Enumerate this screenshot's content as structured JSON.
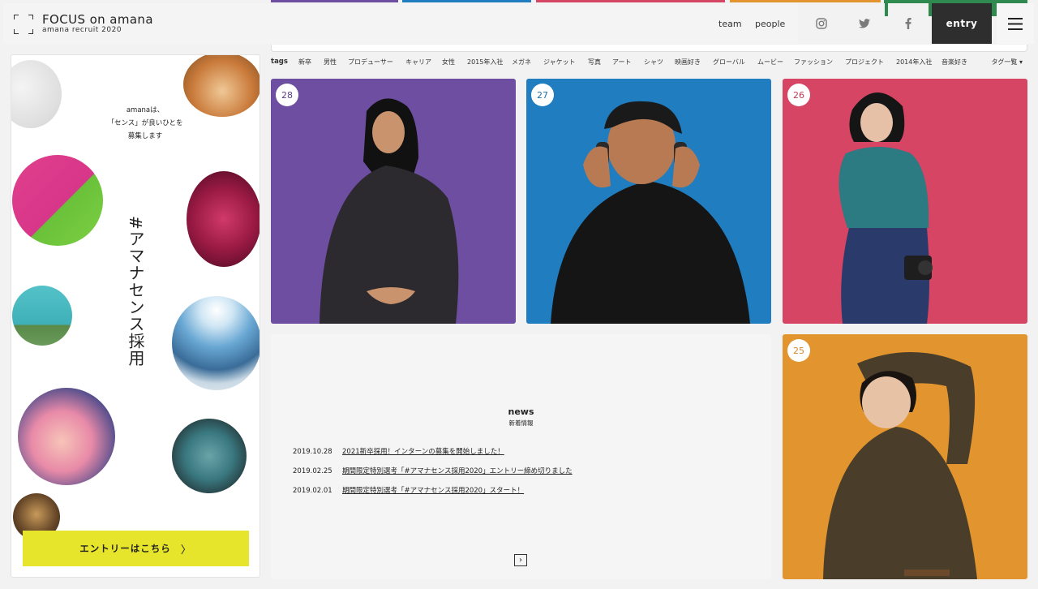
{
  "header": {
    "logo_title": "FOCUS on amana",
    "logo_subtitle": "amana recruit 2020",
    "nav": [
      {
        "label": "team"
      },
      {
        "label": "people"
      }
    ],
    "social": [
      {
        "icon": "instagram-icon"
      },
      {
        "icon": "twitter-icon"
      },
      {
        "icon": "facebook-icon"
      }
    ],
    "entry_label": "entry",
    "menu_icon": "hamburger-menu-icon"
  },
  "tags": {
    "label": "tags",
    "items": [
      "新卒",
      "男性",
      "プロデューサー",
      "キャリア",
      "女性",
      "2015年入社",
      "メガネ",
      "ジャケット",
      "写真",
      "アート",
      "シャツ",
      "映画好き",
      "グローバル",
      "ムービー",
      "ファッション",
      "プロジェクト",
      "2014年入社",
      "音楽好き"
    ],
    "all_label": "タグ一覧 ▾"
  },
  "left_panel": {
    "lead": [
      "amanaは、",
      "「センス」が良いひとを",
      "募集します"
    ],
    "vertical_title": "#アマナセンス採用",
    "cta_label": "エントリーはこちら",
    "cta_icon": "chevron-right-icon"
  },
  "cards": [
    {
      "number": "28",
      "bg": "#6d4ea0",
      "badge_color": "#5a3e8c"
    },
    {
      "number": "27",
      "bg": "#1f7dc0",
      "badge_color": "#1c6fae"
    },
    {
      "number": "26",
      "bg": "#d64563",
      "badge_color": "#c03a55"
    },
    {
      "number": "25",
      "bg": "#e2942f",
      "badge_color": "#d48a2a"
    }
  ],
  "news": {
    "title": "news",
    "subtitle": "新着情報",
    "items": [
      {
        "date": "2019.10.28",
        "text": "2021新卒採用！インターンの募集を開始しました！"
      },
      {
        "date": "2019.02.25",
        "text": "期間限定特別選考「#アマナセンス採用2020」エントリー締め切りました"
      },
      {
        "date": "2019.02.01",
        "text": "期間限定特別選考「#アマナセンス採用2020」スタート！"
      }
    ],
    "next_icon": "chevron-right-box-icon"
  },
  "colors": {
    "accent_yellow": "#e7e52b",
    "entry_dark": "#2e2e2e"
  }
}
